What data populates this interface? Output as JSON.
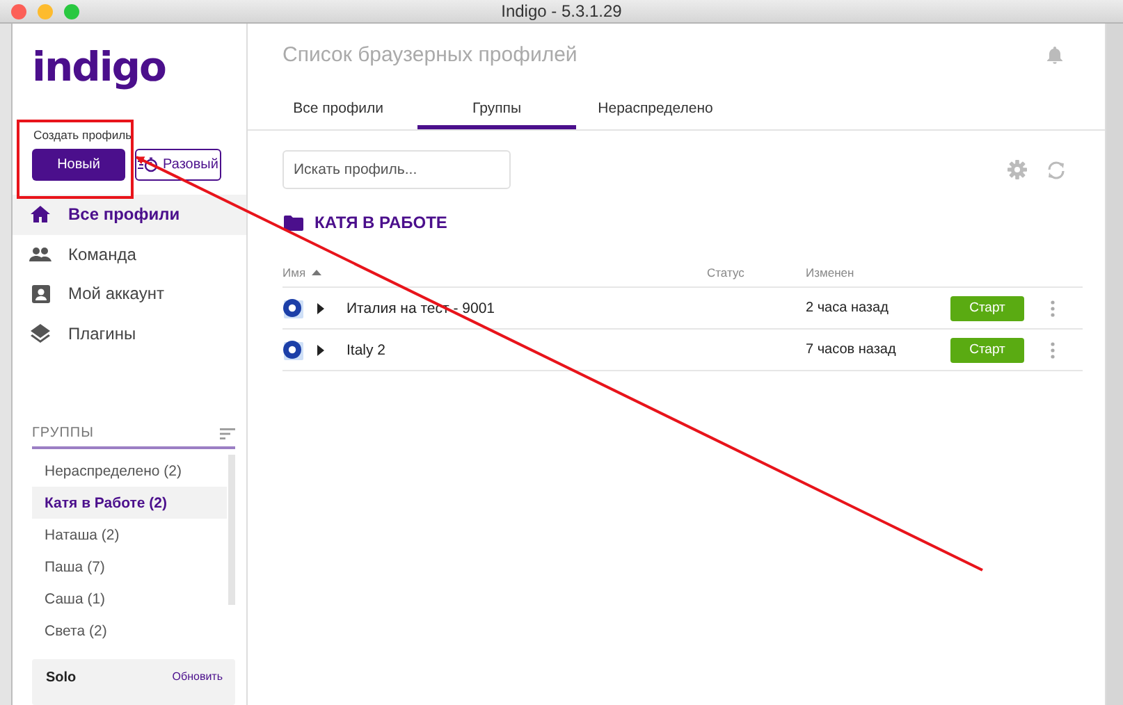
{
  "window": {
    "title": "Indigo - 5.3.1.29"
  },
  "sidebar": {
    "logo": "indigo",
    "create_label": "Создать профиль",
    "create_buttons": [
      {
        "label": "Новый",
        "kind": "primary"
      },
      {
        "label": "Разовый",
        "kind": "outline"
      }
    ],
    "nav": [
      {
        "label": "Все профили",
        "selected": true
      },
      {
        "label": "Команда",
        "selected": false
      },
      {
        "label": "Мой аккаунт",
        "selected": false
      },
      {
        "label": "Плагины",
        "selected": false
      }
    ],
    "groups_title": "ГРУППЫ",
    "groups": [
      {
        "label": "Нераспределено (2)",
        "selected": false
      },
      {
        "label": "Катя в Работе (2)",
        "selected": true
      },
      {
        "label": "Наташа (2)",
        "selected": false
      },
      {
        "label": "Паша (7)",
        "selected": false
      },
      {
        "label": "Саша (1)",
        "selected": false
      },
      {
        "label": "Света (2)",
        "selected": false
      }
    ],
    "plan": {
      "name": "Solo",
      "action": "Обновить"
    }
  },
  "main": {
    "title": "Список браузерных профилей",
    "tabs": [
      {
        "label": "Все профили",
        "selected": false
      },
      {
        "label": "Группы",
        "selected": true
      },
      {
        "label": "Нераспределено",
        "selected": false
      }
    ],
    "search": {
      "placeholder": "Искать профиль..."
    },
    "group_heading": "КАТЯ В РАБОТЕ",
    "columns": [
      "Имя",
      "Статус",
      "Изменен"
    ],
    "rows": [
      {
        "name": "Италия на тест - 9001",
        "changed": "2 часа назад",
        "action": "Старт"
      },
      {
        "name": "Italy 2",
        "changed": "7 часов назад",
        "action": "Старт"
      }
    ]
  }
}
